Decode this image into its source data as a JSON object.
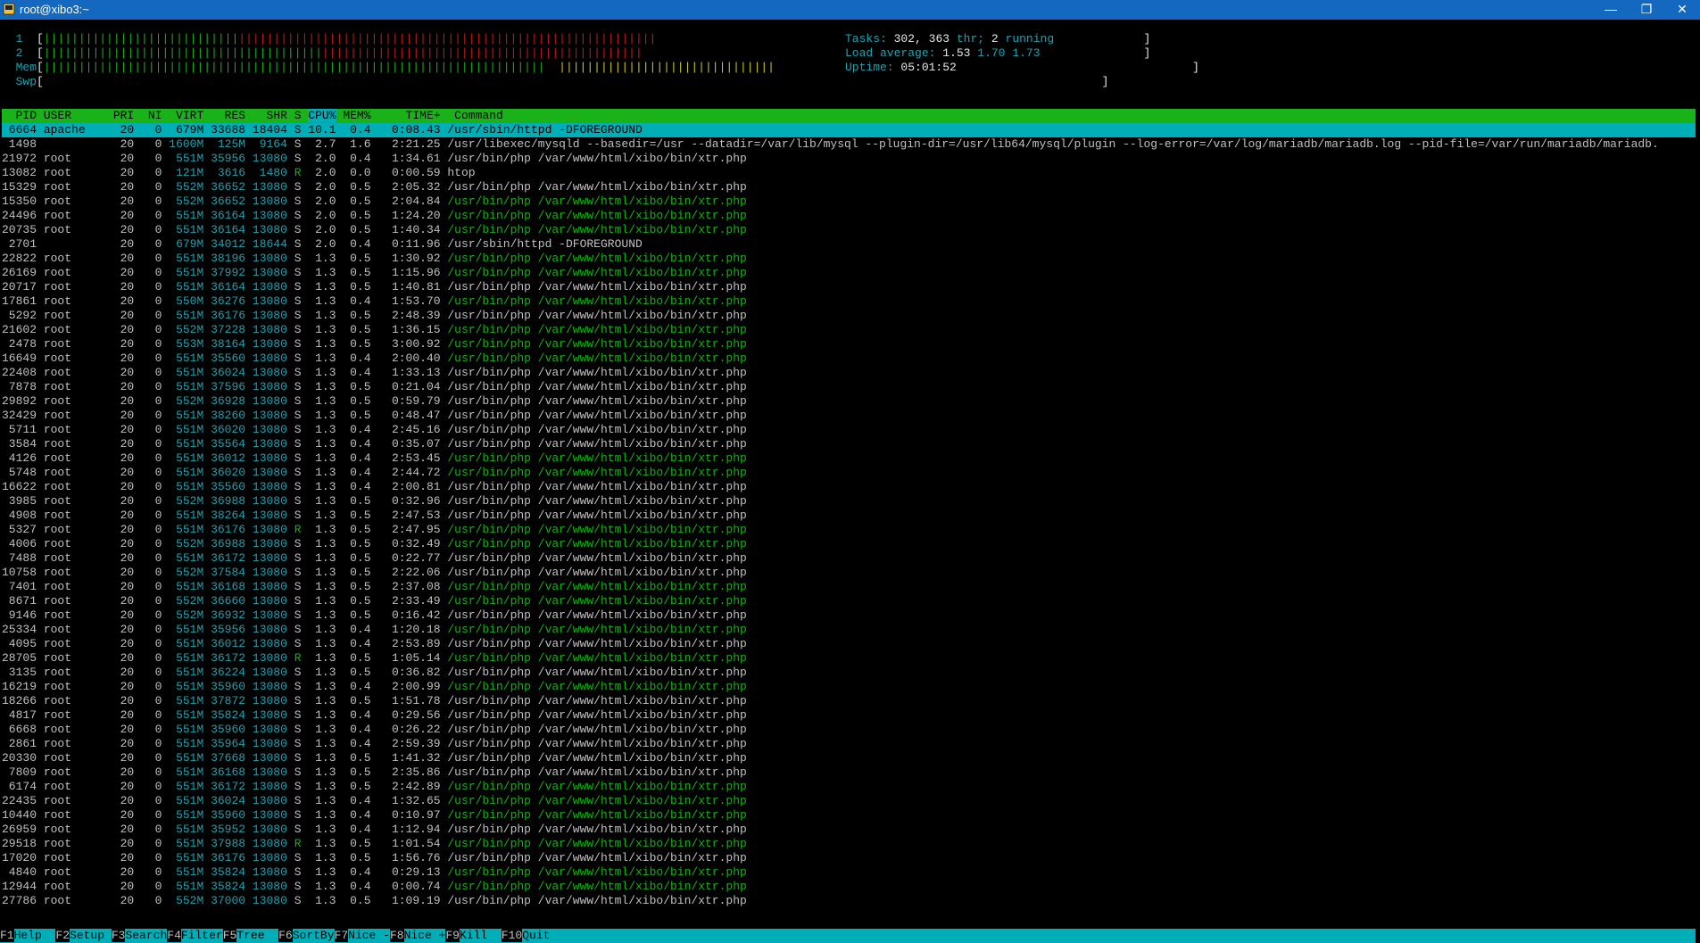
{
  "window": {
    "title": "root@xibo3:~",
    "minimize": "—",
    "restore": "❐",
    "close": "✕"
  },
  "meters": {
    "cpu1_label": "1",
    "cpu2_label": "2",
    "mem_label": "Mem",
    "swp_label": "Swp"
  },
  "summary": {
    "tasks_label": "Tasks:",
    "tasks": "302,",
    "thr": "363",
    "thr_label": "thr;",
    "running": "2",
    "running_label": "running",
    "load_label": "Load average:",
    "load1": "1.53",
    "load5": "1.70",
    "load15": "1.73",
    "uptime_label": "Uptime:",
    "uptime": "05:01:52"
  },
  "columns": {
    "pid": "PID",
    "user": "USER",
    "pri": "PRI",
    "ni": "NI",
    "virt": "VIRT",
    "res": "RES",
    "shr": "SHR",
    "s": "S",
    "cpu": "CPU%",
    "mem": "MEM%",
    "time": "TIME+",
    "command": "Command"
  },
  "processes": [
    {
      "pid": "6664",
      "user": "apache",
      "pri": "20",
      "ni": "0",
      "virt": "679M",
      "res": "33688",
      "shr": "18404",
      "s": "S",
      "cpu": "10.1",
      "mem": "0.4",
      "time": "0:08.43",
      "cmd": "/usr/sbin/httpd -DFOREGROUND",
      "green": false
    },
    {
      "pid": "1498",
      "user": "",
      "pri": "20",
      "ni": "0",
      "virt": "1600M",
      "res": "125M",
      "shr": "9164",
      "s": "S",
      "cpu": "2.7",
      "mem": "1.6",
      "time": "2:21.25",
      "cmd": "/usr/libexec/mysqld --basedir=/usr --datadir=/var/lib/mysql --plugin-dir=/usr/lib64/mysql/plugin --log-error=/var/log/mariadb/mariadb.log --pid-file=/var/run/mariadb/mariadb.",
      "green": false
    },
    {
      "pid": "21972",
      "user": "root",
      "pri": "20",
      "ni": "0",
      "virt": "551M",
      "res": "35956",
      "shr": "13080",
      "s": "S",
      "cpu": "2.0",
      "mem": "0.4",
      "time": "1:34.61",
      "cmd": "/usr/bin/php /var/www/html/xibo/bin/xtr.php",
      "green": false
    },
    {
      "pid": "13082",
      "user": "root",
      "pri": "20",
      "ni": "0",
      "virt": "121M",
      "res": "3616",
      "shr": "1480",
      "s": "R",
      "cpu": "2.0",
      "mem": "0.0",
      "time": "0:00.59",
      "cmd": "htop",
      "green": false
    },
    {
      "pid": "15329",
      "user": "root",
      "pri": "20",
      "ni": "0",
      "virt": "552M",
      "res": "36652",
      "shr": "13080",
      "s": "S",
      "cpu": "2.0",
      "mem": "0.5",
      "time": "2:05.32",
      "cmd": "/usr/bin/php /var/www/html/xibo/bin/xtr.php",
      "green": false
    },
    {
      "pid": "15350",
      "user": "root",
      "pri": "20",
      "ni": "0",
      "virt": "552M",
      "res": "36652",
      "shr": "13080",
      "s": "S",
      "cpu": "2.0",
      "mem": "0.5",
      "time": "2:04.84",
      "cmd": "/usr/bin/php /var/www/html/xibo/bin/xtr.php",
      "green": true
    },
    {
      "pid": "24496",
      "user": "root",
      "pri": "20",
      "ni": "0",
      "virt": "551M",
      "res": "36164",
      "shr": "13080",
      "s": "S",
      "cpu": "2.0",
      "mem": "0.5",
      "time": "1:24.20",
      "cmd": "/usr/bin/php /var/www/html/xibo/bin/xtr.php",
      "green": true
    },
    {
      "pid": "20735",
      "user": "root",
      "pri": "20",
      "ni": "0",
      "virt": "551M",
      "res": "36164",
      "shr": "13080",
      "s": "S",
      "cpu": "2.0",
      "mem": "0.5",
      "time": "1:40.34",
      "cmd": "/usr/bin/php /var/www/html/xibo/bin/xtr.php",
      "green": true
    },
    {
      "pid": "2701",
      "user": "",
      "pri": "20",
      "ni": "0",
      "virt": "679M",
      "res": "34012",
      "shr": "18644",
      "s": "S",
      "cpu": "2.0",
      "mem": "0.4",
      "time": "0:11.96",
      "cmd": "/usr/sbin/httpd -DFOREGROUND",
      "green": false
    },
    {
      "pid": "22822",
      "user": "root",
      "pri": "20",
      "ni": "0",
      "virt": "551M",
      "res": "38196",
      "shr": "13080",
      "s": "S",
      "cpu": "1.3",
      "mem": "0.5",
      "time": "1:30.92",
      "cmd": "/usr/bin/php /var/www/html/xibo/bin/xtr.php",
      "green": true
    },
    {
      "pid": "26169",
      "user": "root",
      "pri": "20",
      "ni": "0",
      "virt": "551M",
      "res": "37992",
      "shr": "13080",
      "s": "S",
      "cpu": "1.3",
      "mem": "0.5",
      "time": "1:15.96",
      "cmd": "/usr/bin/php /var/www/html/xibo/bin/xtr.php",
      "green": true
    },
    {
      "pid": "20717",
      "user": "root",
      "pri": "20",
      "ni": "0",
      "virt": "551M",
      "res": "36164",
      "shr": "13080",
      "s": "S",
      "cpu": "1.3",
      "mem": "0.5",
      "time": "1:40.81",
      "cmd": "/usr/bin/php /var/www/html/xibo/bin/xtr.php",
      "green": false
    },
    {
      "pid": "17861",
      "user": "root",
      "pri": "20",
      "ni": "0",
      "virt": "550M",
      "res": "36276",
      "shr": "13080",
      "s": "S",
      "cpu": "1.3",
      "mem": "0.4",
      "time": "1:53.70",
      "cmd": "/usr/bin/php /var/www/html/xibo/bin/xtr.php",
      "green": true
    },
    {
      "pid": "5292",
      "user": "root",
      "pri": "20",
      "ni": "0",
      "virt": "551M",
      "res": "36176",
      "shr": "13080",
      "s": "S",
      "cpu": "1.3",
      "mem": "0.5",
      "time": "2:48.39",
      "cmd": "/usr/bin/php /var/www/html/xibo/bin/xtr.php",
      "green": false
    },
    {
      "pid": "21602",
      "user": "root",
      "pri": "20",
      "ni": "0",
      "virt": "552M",
      "res": "37228",
      "shr": "13080",
      "s": "S",
      "cpu": "1.3",
      "mem": "0.5",
      "time": "1:36.15",
      "cmd": "/usr/bin/php /var/www/html/xibo/bin/xtr.php",
      "green": true
    },
    {
      "pid": "2478",
      "user": "root",
      "pri": "20",
      "ni": "0",
      "virt": "553M",
      "res": "38164",
      "shr": "13080",
      "s": "S",
      "cpu": "1.3",
      "mem": "0.5",
      "time": "3:00.92",
      "cmd": "/usr/bin/php /var/www/html/xibo/bin/xtr.php",
      "green": true
    },
    {
      "pid": "16649",
      "user": "root",
      "pri": "20",
      "ni": "0",
      "virt": "551M",
      "res": "35560",
      "shr": "13080",
      "s": "S",
      "cpu": "1.3",
      "mem": "0.4",
      "time": "2:00.40",
      "cmd": "/usr/bin/php /var/www/html/xibo/bin/xtr.php",
      "green": true
    },
    {
      "pid": "22408",
      "user": "root",
      "pri": "20",
      "ni": "0",
      "virt": "551M",
      "res": "36024",
      "shr": "13080",
      "s": "S",
      "cpu": "1.3",
      "mem": "0.4",
      "time": "1:33.13",
      "cmd": "/usr/bin/php /var/www/html/xibo/bin/xtr.php",
      "green": false
    },
    {
      "pid": "7878",
      "user": "root",
      "pri": "20",
      "ni": "0",
      "virt": "551M",
      "res": "37596",
      "shr": "13080",
      "s": "S",
      "cpu": "1.3",
      "mem": "0.5",
      "time": "0:21.04",
      "cmd": "/usr/bin/php /var/www/html/xibo/bin/xtr.php",
      "green": false
    },
    {
      "pid": "29892",
      "user": "root",
      "pri": "20",
      "ni": "0",
      "virt": "552M",
      "res": "36928",
      "shr": "13080",
      "s": "S",
      "cpu": "1.3",
      "mem": "0.5",
      "time": "0:59.79",
      "cmd": "/usr/bin/php /var/www/html/xibo/bin/xtr.php",
      "green": false
    },
    {
      "pid": "32429",
      "user": "root",
      "pri": "20",
      "ni": "0",
      "virt": "551M",
      "res": "38260",
      "shr": "13080",
      "s": "S",
      "cpu": "1.3",
      "mem": "0.5",
      "time": "0:48.47",
      "cmd": "/usr/bin/php /var/www/html/xibo/bin/xtr.php",
      "green": false
    },
    {
      "pid": "5711",
      "user": "root",
      "pri": "20",
      "ni": "0",
      "virt": "551M",
      "res": "36020",
      "shr": "13080",
      "s": "S",
      "cpu": "1.3",
      "mem": "0.4",
      "time": "2:45.16",
      "cmd": "/usr/bin/php /var/www/html/xibo/bin/xtr.php",
      "green": false
    },
    {
      "pid": "3584",
      "user": "root",
      "pri": "20",
      "ni": "0",
      "virt": "551M",
      "res": "35564",
      "shr": "13080",
      "s": "S",
      "cpu": "1.3",
      "mem": "0.4",
      "time": "0:35.07",
      "cmd": "/usr/bin/php /var/www/html/xibo/bin/xtr.php",
      "green": false
    },
    {
      "pid": "4126",
      "user": "root",
      "pri": "20",
      "ni": "0",
      "virt": "551M",
      "res": "36012",
      "shr": "13080",
      "s": "S",
      "cpu": "1.3",
      "mem": "0.4",
      "time": "2:53.45",
      "cmd": "/usr/bin/php /var/www/html/xibo/bin/xtr.php",
      "green": true
    },
    {
      "pid": "5748",
      "user": "root",
      "pri": "20",
      "ni": "0",
      "virt": "551M",
      "res": "36020",
      "shr": "13080",
      "s": "S",
      "cpu": "1.3",
      "mem": "0.4",
      "time": "2:44.72",
      "cmd": "/usr/bin/php /var/www/html/xibo/bin/xtr.php",
      "green": true
    },
    {
      "pid": "16622",
      "user": "root",
      "pri": "20",
      "ni": "0",
      "virt": "551M",
      "res": "35560",
      "shr": "13080",
      "s": "S",
      "cpu": "1.3",
      "mem": "0.4",
      "time": "2:00.81",
      "cmd": "/usr/bin/php /var/www/html/xibo/bin/xtr.php",
      "green": false
    },
    {
      "pid": "3985",
      "user": "root",
      "pri": "20",
      "ni": "0",
      "virt": "552M",
      "res": "36988",
      "shr": "13080",
      "s": "S",
      "cpu": "1.3",
      "mem": "0.5",
      "time": "0:32.96",
      "cmd": "/usr/bin/php /var/www/html/xibo/bin/xtr.php",
      "green": false
    },
    {
      "pid": "4908",
      "user": "root",
      "pri": "20",
      "ni": "0",
      "virt": "551M",
      "res": "38264",
      "shr": "13080",
      "s": "S",
      "cpu": "1.3",
      "mem": "0.5",
      "time": "2:47.53",
      "cmd": "/usr/bin/php /var/www/html/xibo/bin/xtr.php",
      "green": false
    },
    {
      "pid": "5327",
      "user": "root",
      "pri": "20",
      "ni": "0",
      "virt": "551M",
      "res": "36176",
      "shr": "13080",
      "s": "R",
      "cpu": "1.3",
      "mem": "0.5",
      "time": "2:47.95",
      "cmd": "/usr/bin/php /var/www/html/xibo/bin/xtr.php",
      "green": true
    },
    {
      "pid": "4006",
      "user": "root",
      "pri": "20",
      "ni": "0",
      "virt": "552M",
      "res": "36988",
      "shr": "13080",
      "s": "S",
      "cpu": "1.3",
      "mem": "0.5",
      "time": "0:32.49",
      "cmd": "/usr/bin/php /var/www/html/xibo/bin/xtr.php",
      "green": true
    },
    {
      "pid": "7488",
      "user": "root",
      "pri": "20",
      "ni": "0",
      "virt": "551M",
      "res": "36172",
      "shr": "13080",
      "s": "S",
      "cpu": "1.3",
      "mem": "0.5",
      "time": "0:22.77",
      "cmd": "/usr/bin/php /var/www/html/xibo/bin/xtr.php",
      "green": false
    },
    {
      "pid": "10758",
      "user": "root",
      "pri": "20",
      "ni": "0",
      "virt": "552M",
      "res": "37584",
      "shr": "13080",
      "s": "S",
      "cpu": "1.3",
      "mem": "0.5",
      "time": "2:22.06",
      "cmd": "/usr/bin/php /var/www/html/xibo/bin/xtr.php",
      "green": false
    },
    {
      "pid": "7401",
      "user": "root",
      "pri": "20",
      "ni": "0",
      "virt": "551M",
      "res": "36168",
      "shr": "13080",
      "s": "S",
      "cpu": "1.3",
      "mem": "0.5",
      "time": "2:37.08",
      "cmd": "/usr/bin/php /var/www/html/xibo/bin/xtr.php",
      "green": true
    },
    {
      "pid": "8671",
      "user": "root",
      "pri": "20",
      "ni": "0",
      "virt": "552M",
      "res": "36660",
      "shr": "13080",
      "s": "S",
      "cpu": "1.3",
      "mem": "0.5",
      "time": "2:33.49",
      "cmd": "/usr/bin/php /var/www/html/xibo/bin/xtr.php",
      "green": true
    },
    {
      "pid": "9146",
      "user": "root",
      "pri": "20",
      "ni": "0",
      "virt": "552M",
      "res": "36932",
      "shr": "13080",
      "s": "S",
      "cpu": "1.3",
      "mem": "0.5",
      "time": "0:16.42",
      "cmd": "/usr/bin/php /var/www/html/xibo/bin/xtr.php",
      "green": false
    },
    {
      "pid": "25334",
      "user": "root",
      "pri": "20",
      "ni": "0",
      "virt": "551M",
      "res": "35956",
      "shr": "13080",
      "s": "S",
      "cpu": "1.3",
      "mem": "0.4",
      "time": "1:20.18",
      "cmd": "/usr/bin/php /var/www/html/xibo/bin/xtr.php",
      "green": true
    },
    {
      "pid": "4095",
      "user": "root",
      "pri": "20",
      "ni": "0",
      "virt": "551M",
      "res": "36012",
      "shr": "13080",
      "s": "S",
      "cpu": "1.3",
      "mem": "0.4",
      "time": "2:53.89",
      "cmd": "/usr/bin/php /var/www/html/xibo/bin/xtr.php",
      "green": false
    },
    {
      "pid": "28705",
      "user": "root",
      "pri": "20",
      "ni": "0",
      "virt": "551M",
      "res": "36172",
      "shr": "13080",
      "s": "R",
      "cpu": "1.3",
      "mem": "0.5",
      "time": "1:05.14",
      "cmd": "/usr/bin/php /var/www/html/xibo/bin/xtr.php",
      "green": true
    },
    {
      "pid": "3135",
      "user": "root",
      "pri": "20",
      "ni": "0",
      "virt": "551M",
      "res": "36224",
      "shr": "13080",
      "s": "S",
      "cpu": "1.3",
      "mem": "0.5",
      "time": "0:36.82",
      "cmd": "/usr/bin/php /var/www/html/xibo/bin/xtr.php",
      "green": false
    },
    {
      "pid": "16219",
      "user": "root",
      "pri": "20",
      "ni": "0",
      "virt": "551M",
      "res": "35960",
      "shr": "13080",
      "s": "S",
      "cpu": "1.3",
      "mem": "0.4",
      "time": "2:00.99",
      "cmd": "/usr/bin/php /var/www/html/xibo/bin/xtr.php",
      "green": true
    },
    {
      "pid": "18266",
      "user": "root",
      "pri": "20",
      "ni": "0",
      "virt": "551M",
      "res": "37872",
      "shr": "13080",
      "s": "S",
      "cpu": "1.3",
      "mem": "0.5",
      "time": "1:51.78",
      "cmd": "/usr/bin/php /var/www/html/xibo/bin/xtr.php",
      "green": false
    },
    {
      "pid": "4817",
      "user": "root",
      "pri": "20",
      "ni": "0",
      "virt": "551M",
      "res": "35824",
      "shr": "13080",
      "s": "S",
      "cpu": "1.3",
      "mem": "0.4",
      "time": "0:29.56",
      "cmd": "/usr/bin/php /var/www/html/xibo/bin/xtr.php",
      "green": false
    },
    {
      "pid": "6668",
      "user": "root",
      "pri": "20",
      "ni": "0",
      "virt": "551M",
      "res": "35960",
      "shr": "13080",
      "s": "S",
      "cpu": "1.3",
      "mem": "0.4",
      "time": "0:26.22",
      "cmd": "/usr/bin/php /var/www/html/xibo/bin/xtr.php",
      "green": false
    },
    {
      "pid": "2861",
      "user": "root",
      "pri": "20",
      "ni": "0",
      "virt": "551M",
      "res": "35964",
      "shr": "13080",
      "s": "S",
      "cpu": "1.3",
      "mem": "0.4",
      "time": "2:59.39",
      "cmd": "/usr/bin/php /var/www/html/xibo/bin/xtr.php",
      "green": false
    },
    {
      "pid": "20330",
      "user": "root",
      "pri": "20",
      "ni": "0",
      "virt": "551M",
      "res": "37668",
      "shr": "13080",
      "s": "S",
      "cpu": "1.3",
      "mem": "0.5",
      "time": "1:41.32",
      "cmd": "/usr/bin/php /var/www/html/xibo/bin/xtr.php",
      "green": false
    },
    {
      "pid": "7809",
      "user": "root",
      "pri": "20",
      "ni": "0",
      "virt": "551M",
      "res": "36168",
      "shr": "13080",
      "s": "S",
      "cpu": "1.3",
      "mem": "0.5",
      "time": "2:35.86",
      "cmd": "/usr/bin/php /var/www/html/xibo/bin/xtr.php",
      "green": false
    },
    {
      "pid": "6174",
      "user": "root",
      "pri": "20",
      "ni": "0",
      "virt": "551M",
      "res": "36172",
      "shr": "13080",
      "s": "S",
      "cpu": "1.3",
      "mem": "0.5",
      "time": "2:42.89",
      "cmd": "/usr/bin/php /var/www/html/xibo/bin/xtr.php",
      "green": true
    },
    {
      "pid": "22435",
      "user": "root",
      "pri": "20",
      "ni": "0",
      "virt": "551M",
      "res": "36024",
      "shr": "13080",
      "s": "S",
      "cpu": "1.3",
      "mem": "0.4",
      "time": "1:32.65",
      "cmd": "/usr/bin/php /var/www/html/xibo/bin/xtr.php",
      "green": true
    },
    {
      "pid": "10440",
      "user": "root",
      "pri": "20",
      "ni": "0",
      "virt": "551M",
      "res": "35960",
      "shr": "13080",
      "s": "S",
      "cpu": "1.3",
      "mem": "0.4",
      "time": "0:10.97",
      "cmd": "/usr/bin/php /var/www/html/xibo/bin/xtr.php",
      "green": true
    },
    {
      "pid": "26959",
      "user": "root",
      "pri": "20",
      "ni": "0",
      "virt": "551M",
      "res": "35952",
      "shr": "13080",
      "s": "S",
      "cpu": "1.3",
      "mem": "0.4",
      "time": "1:12.94",
      "cmd": "/usr/bin/php /var/www/html/xibo/bin/xtr.php",
      "green": false
    },
    {
      "pid": "29518",
      "user": "root",
      "pri": "20",
      "ni": "0",
      "virt": "551M",
      "res": "37988",
      "shr": "13080",
      "s": "R",
      "cpu": "1.3",
      "mem": "0.5",
      "time": "1:01.54",
      "cmd": "/usr/bin/php /var/www/html/xibo/bin/xtr.php",
      "green": true
    },
    {
      "pid": "17020",
      "user": "root",
      "pri": "20",
      "ni": "0",
      "virt": "551M",
      "res": "36176",
      "shr": "13080",
      "s": "S",
      "cpu": "1.3",
      "mem": "0.5",
      "time": "1:56.76",
      "cmd": "/usr/bin/php /var/www/html/xibo/bin/xtr.php",
      "green": false
    },
    {
      "pid": "4840",
      "user": "root",
      "pri": "20",
      "ni": "0",
      "virt": "551M",
      "res": "35824",
      "shr": "13080",
      "s": "S",
      "cpu": "1.3",
      "mem": "0.4",
      "time": "0:29.13",
      "cmd": "/usr/bin/php /var/www/html/xibo/bin/xtr.php",
      "green": true
    },
    {
      "pid": "12944",
      "user": "root",
      "pri": "20",
      "ni": "0",
      "virt": "551M",
      "res": "35824",
      "shr": "13080",
      "s": "S",
      "cpu": "1.3",
      "mem": "0.4",
      "time": "0:00.74",
      "cmd": "/usr/bin/php /var/www/html/xibo/bin/xtr.php",
      "green": true
    },
    {
      "pid": "27786",
      "user": "root",
      "pri": "20",
      "ni": "0",
      "virt": "552M",
      "res": "37000",
      "shr": "13080",
      "s": "S",
      "cpu": "1.3",
      "mem": "0.5",
      "time": "1:09.19",
      "cmd": "/usr/bin/php /var/www/html/xibo/bin/xtr.php",
      "green": false
    }
  ],
  "fkeys": [
    {
      "key": "F1",
      "label": "Help"
    },
    {
      "key": "F2",
      "label": "Setup"
    },
    {
      "key": "F3",
      "label": "Search"
    },
    {
      "key": "F4",
      "label": "Filter"
    },
    {
      "key": "F5",
      "label": "Tree"
    },
    {
      "key": "F6",
      "label": "SortBy"
    },
    {
      "key": "F7",
      "label": "Nice -"
    },
    {
      "key": "F8",
      "label": "Nice +"
    },
    {
      "key": "F9",
      "label": "Kill"
    },
    {
      "key": "F10",
      "label": "Quit"
    }
  ],
  "colors": {
    "titlebar": "#1568c0",
    "header_green": "#19b319",
    "selection_cyan": "#00aeb8",
    "text_gray": "#c0c0c0",
    "process_green": "#16b016"
  }
}
